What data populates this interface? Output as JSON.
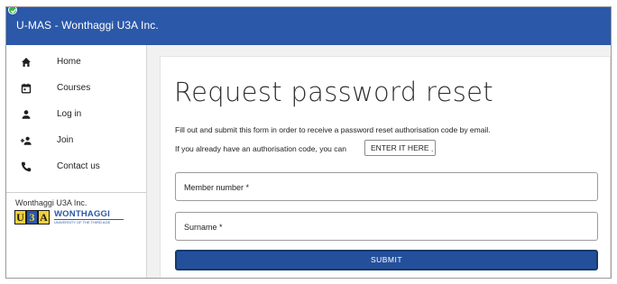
{
  "app": {
    "title": "U-MAS - Wonthaggi U3A Inc."
  },
  "sidebar": {
    "items": [
      {
        "label": "Home",
        "icon": "home-icon"
      },
      {
        "label": "Courses",
        "icon": "calendar-icon"
      },
      {
        "label": "Log in",
        "icon": "person-icon"
      },
      {
        "label": "Join",
        "icon": "person-add-icon"
      },
      {
        "label": "Contact us",
        "icon": "phone-icon"
      }
    ],
    "org_name": "Wonthaggi U3A Inc.",
    "logo": {
      "letters": [
        "U",
        "3",
        "A"
      ],
      "name": "WONTHAGGI",
      "subtitle": "UNIVERSITY OF THE THIRD AGE"
    }
  },
  "main": {
    "title": "Request password reset",
    "description": "Fill out and submit this form in order to receive a password reset authorisation code by email.",
    "code_prompt": "If you already have an authorisation code, you can",
    "enter_button": "ENTER IT HERE",
    "code_prompt_end": ".",
    "fields": {
      "member_number": "Member number *",
      "surname": "Surname *"
    },
    "submit_label": "SUBMIT"
  },
  "colors": {
    "header": "#2b58a8",
    "status": "#3bb54a",
    "submit": "#24509b",
    "logo_yellow": "#f2d03b"
  }
}
